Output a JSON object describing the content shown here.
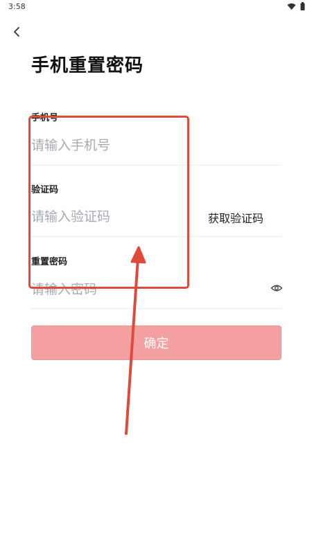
{
  "status_bar": {
    "time": "3:58",
    "icons": [
      "wifi-icon",
      "battery-icon"
    ]
  },
  "header": {
    "back_icon": "chevron-left-icon",
    "title": "手机重置密码"
  },
  "form": {
    "phone": {
      "label": "手机号",
      "placeholder": "请输入手机号",
      "value": ""
    },
    "code": {
      "label": "验证码",
      "placeholder": "请输入验证码",
      "value": "",
      "get_code_label": "获取验证码"
    },
    "password": {
      "label": "重置密码",
      "placeholder": "请输入密码",
      "value": "",
      "visibility_icon": "eye-icon"
    },
    "confirm_label": "确定"
  },
  "colors": {
    "confirm_button": "#f4a0a1",
    "annotation": "#e04a3a",
    "placeholder": "#a8aab3"
  }
}
